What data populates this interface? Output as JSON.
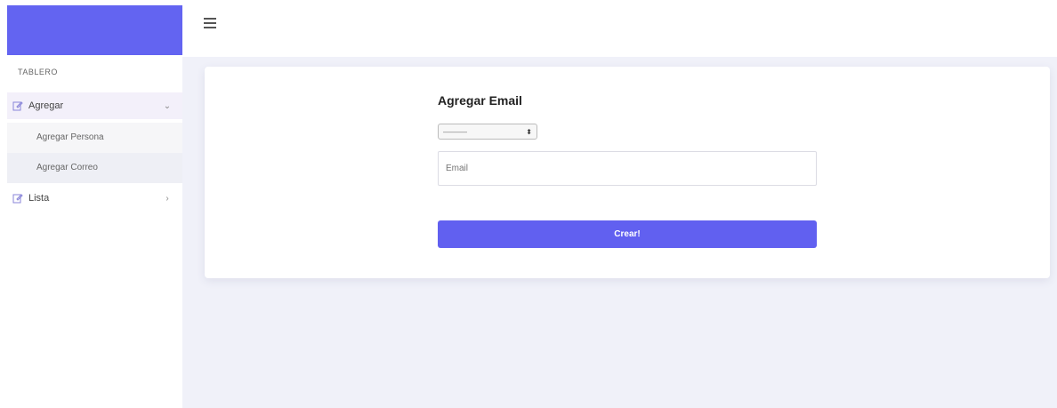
{
  "sidebar": {
    "section_title": "TABLERO",
    "items": [
      {
        "label": "Agregar",
        "icon": "edit-icon",
        "expanded": true,
        "children": [
          {
            "label": "Agregar Persona"
          },
          {
            "label": "Agregar Correo"
          }
        ]
      },
      {
        "label": "Lista",
        "icon": "edit-icon",
        "expanded": false
      }
    ]
  },
  "form": {
    "title": "Agregar Email",
    "select_value": "———",
    "email_placeholder": "Email",
    "submit_label": "Crear!"
  },
  "colors": {
    "brand": "#6364f1",
    "button": "#6160f0",
    "content_bg": "#f0f1f9"
  }
}
